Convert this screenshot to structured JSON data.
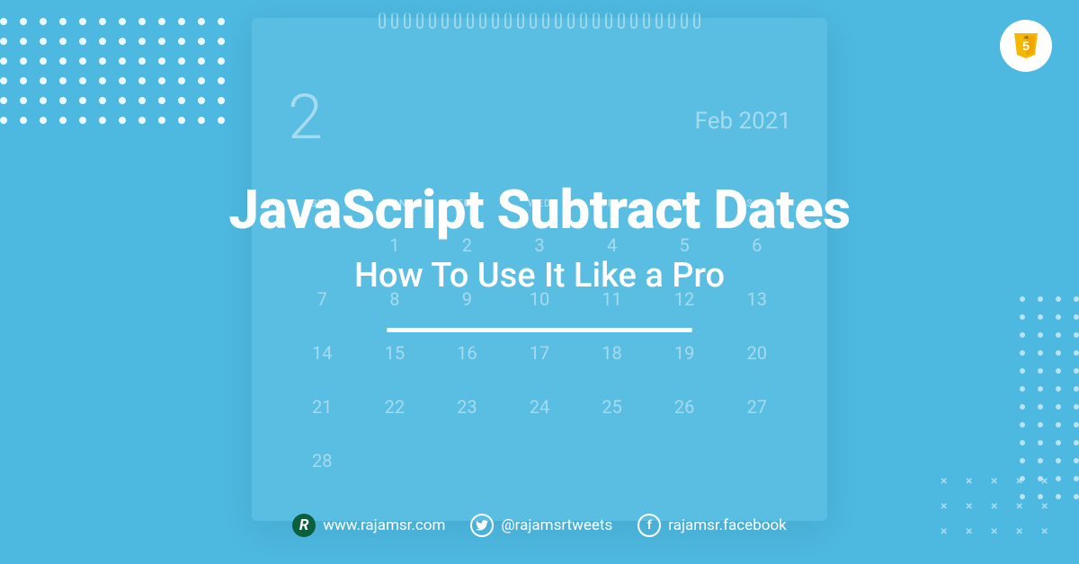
{
  "title": "JavaScript Subtract Dates",
  "subtitle": "How To Use It Like a Pro",
  "calendar": {
    "month_number": "2",
    "month_label": "Feb 2021",
    "dow": [
      "SUN",
      "MON",
      "TUE",
      "WED",
      "THU",
      "FRI",
      "SAT"
    ],
    "days": [
      "",
      "1",
      "2",
      "3",
      "4",
      "5",
      "6",
      "7",
      "8",
      "9",
      "10",
      "11",
      "12",
      "13",
      "14",
      "15",
      "16",
      "17",
      "18",
      "19",
      "20",
      "21",
      "22",
      "23",
      "24",
      "25",
      "26",
      "27",
      "28"
    ]
  },
  "socials": {
    "website": "www.rajamsr.com",
    "twitter": "@rajamsrtweets",
    "facebook": "rajamsr.facebook"
  }
}
